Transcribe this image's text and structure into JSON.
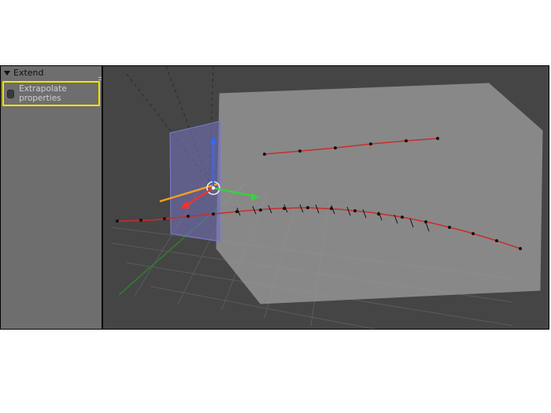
{
  "sidebar": {
    "panel_title": "Extend",
    "extrapolate_label": "Extrapolate properties",
    "extrapolate_checked": false
  },
  "viewport": {
    "gizmo": {
      "axis_x_color": "#ff2e2e",
      "axis_y_color": "#3ad23a",
      "axis_z_color": "#2e6bff"
    },
    "accent_color": "#ff9f1c",
    "grid_color": "#5a5a5a",
    "mesh_fill": "#9b9b9b",
    "mesh_fill_inner": "#6f6fb3",
    "curve_color": "#ca2d2d",
    "vertex_color": "#111111"
  }
}
